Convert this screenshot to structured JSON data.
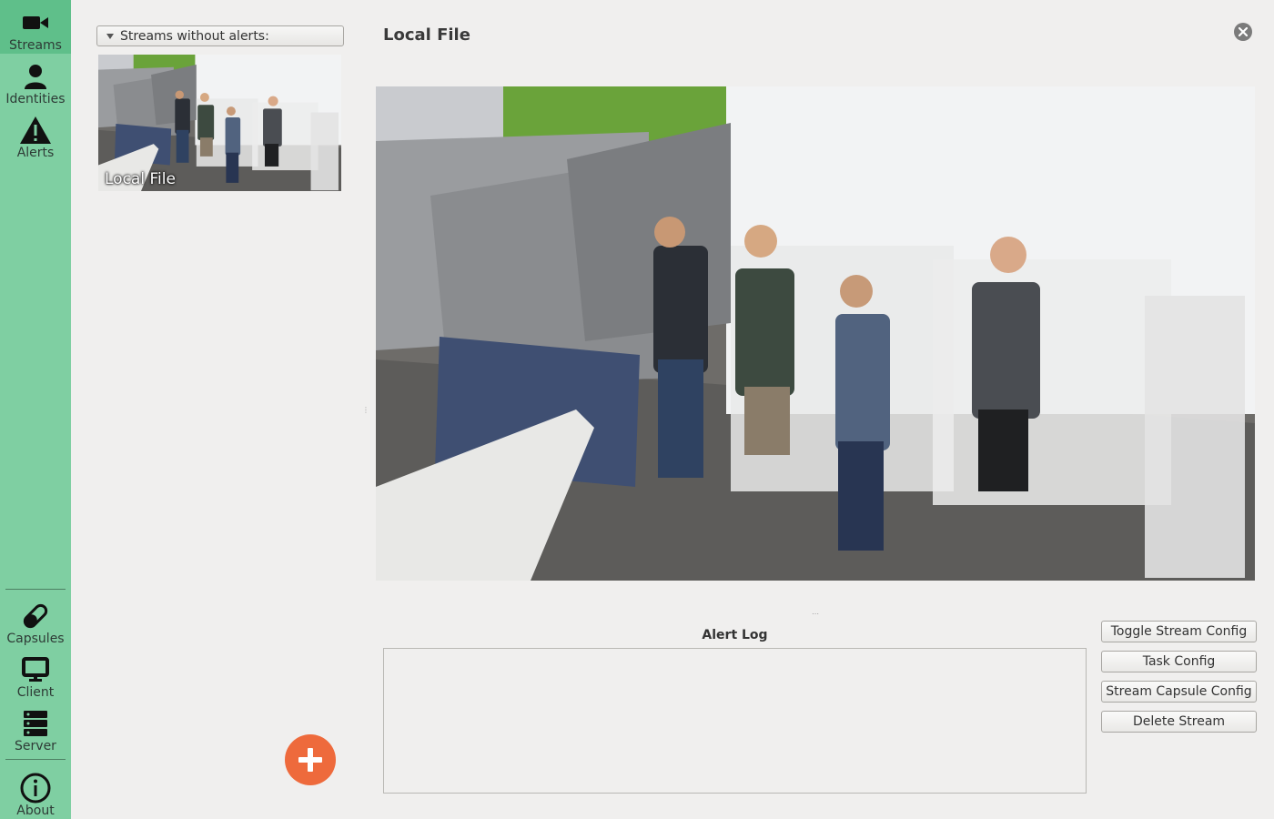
{
  "sidebar": {
    "top_items": [
      {
        "label": "Streams",
        "icon": "video-camera-icon",
        "active": true
      },
      {
        "label": "Identities",
        "icon": "person-icon",
        "active": false
      },
      {
        "label": "Alerts",
        "icon": "warning-icon",
        "active": false
      }
    ],
    "bottom_items": [
      {
        "label": "Capsules",
        "icon": "capsule-icon"
      },
      {
        "label": "Client",
        "icon": "monitor-icon"
      },
      {
        "label": "Server",
        "icon": "server-icon"
      },
      {
        "label": "About",
        "icon": "info-icon"
      }
    ],
    "colors": {
      "background": "#7fcfa2",
      "active": "#5fbf8a"
    }
  },
  "stream_list": {
    "filter_label": "Streams without alerts:",
    "streams": [
      {
        "name": "Local File"
      }
    ],
    "add_button_icon": "plus-icon",
    "add_button_color": "#ee6a3c"
  },
  "main": {
    "title": "Local File",
    "close_icon": "close-icon",
    "alert_log": {
      "title": "Alert Log",
      "entries": []
    },
    "buttons": {
      "toggle_stream_config": "Toggle Stream Config",
      "task_config": "Task Config",
      "stream_capsule_config": "Stream Capsule Config",
      "delete_stream": "Delete Stream"
    }
  }
}
